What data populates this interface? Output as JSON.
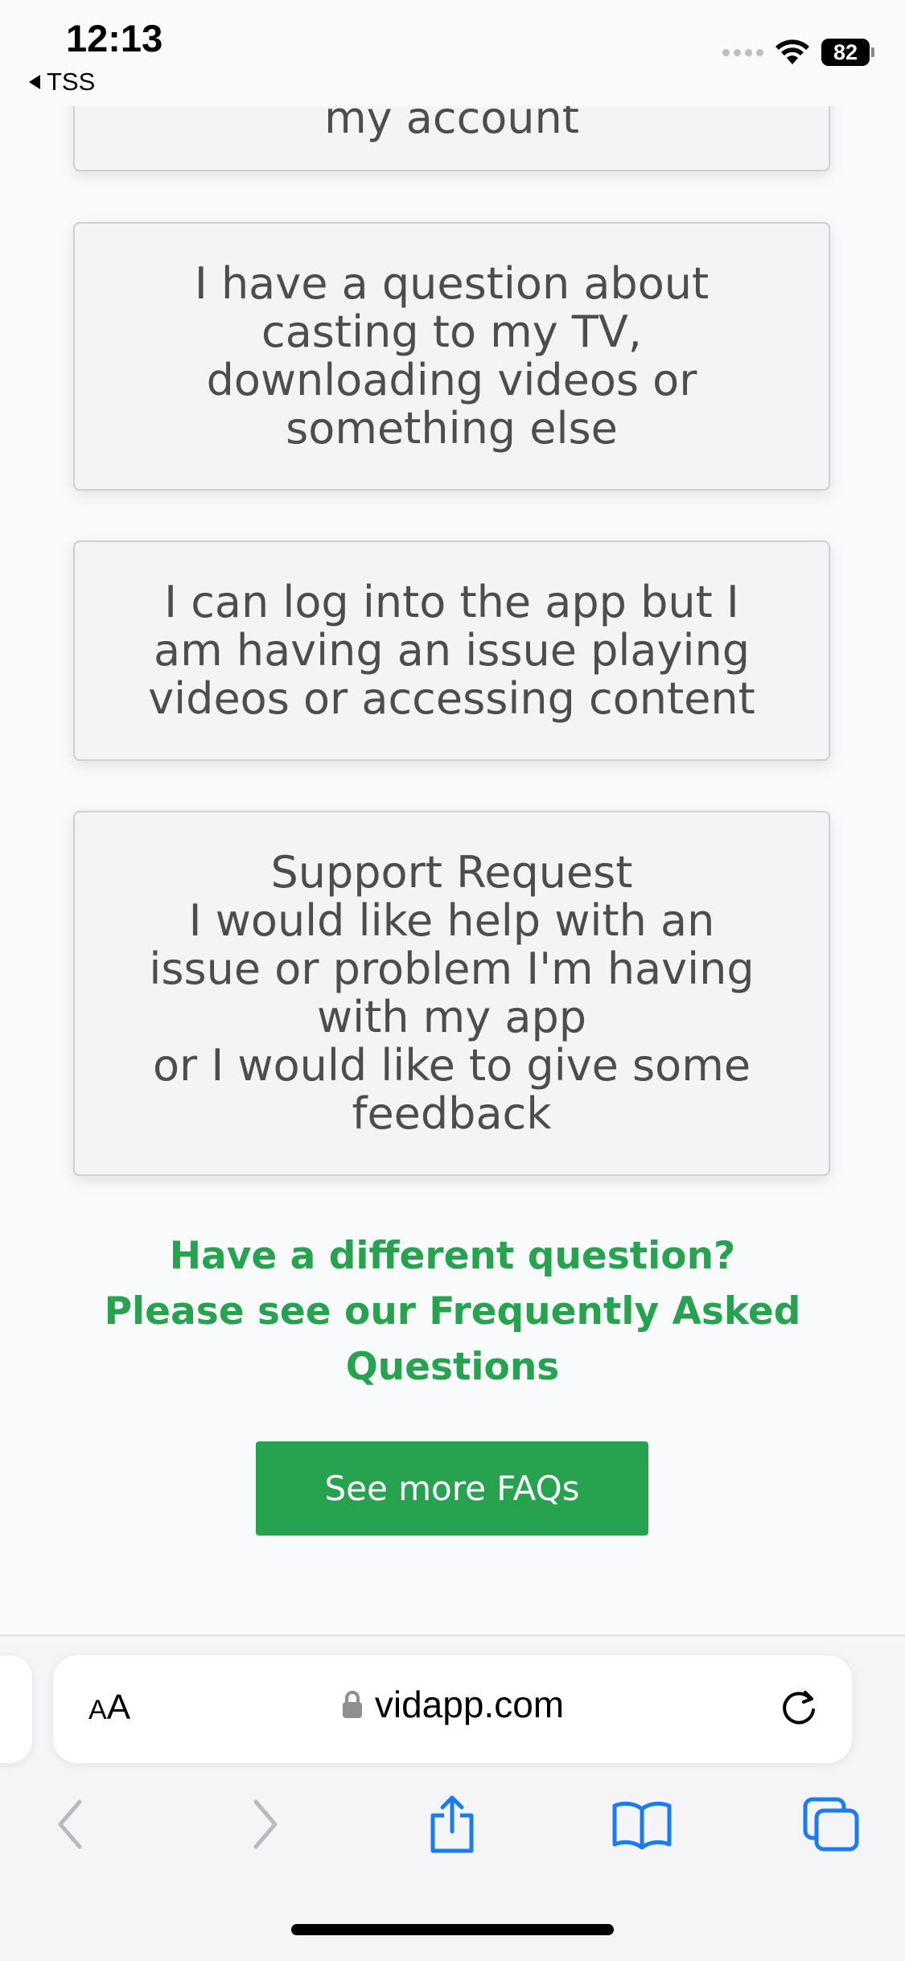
{
  "status_bar": {
    "time": "12:13",
    "back_app": "TSS",
    "battery": "82"
  },
  "cards": [
    {
      "text": "my account"
    },
    {
      "text": "I have a question about\ncasting to my TV,\ndownloading videos or\nsomething else"
    },
    {
      "text": "I can log into the app but I\nam having an issue playing\nvideos or accessing content"
    },
    {
      "text": "Support Request\nI would like help with an\nissue or problem I'm having\nwith my app\nor I would like to give some\nfeedback"
    }
  ],
  "faq": {
    "heading_line1": "Have a different question?",
    "heading_line2": "Please see our Frequently Asked Questions",
    "button_label": "See more FAQs"
  },
  "browser": {
    "url": "vidapp.com",
    "text_size_small": "A",
    "text_size_big": "A"
  },
  "colors": {
    "accent_green": "#27a24f",
    "toolbar_blue": "#1a7cf5",
    "toolbar_disabled": "#b9b9bf"
  },
  "icons": {
    "back": "chevron-left-icon",
    "forward": "chevron-right-icon",
    "share": "share-icon",
    "bookmarks": "book-icon",
    "tabs": "tabs-icon",
    "lock": "lock-icon",
    "reload": "reload-icon"
  }
}
